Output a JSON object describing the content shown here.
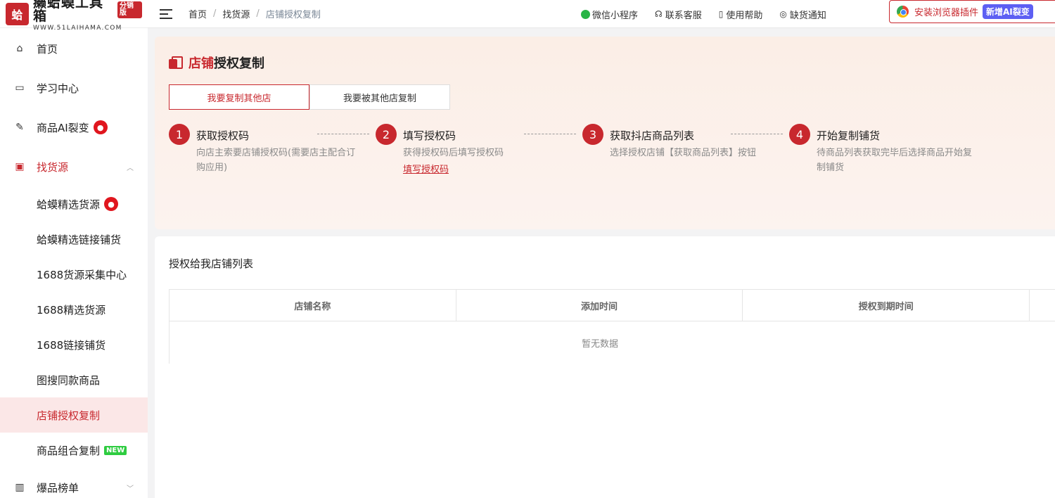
{
  "brand": {
    "logo_char": "蛤",
    "title": "癞蛤蟆工具箱",
    "badge": "分销版",
    "url": "WWW.51LAIHAMA.COM"
  },
  "sidebar": {
    "items": [
      {
        "label": "首页",
        "icon": "home-icon"
      },
      {
        "label": "学习中心",
        "icon": "book-icon"
      },
      {
        "label": "商品AI裂变",
        "icon": "magic-wand-icon",
        "badge": "fire"
      },
      {
        "label": "找货源",
        "icon": "bag-icon",
        "expanded": true
      },
      {
        "label": "蛤蟆精选货源",
        "badge": "fire"
      },
      {
        "label": "蛤蟆精选链接铺货"
      },
      {
        "label": "1688货源采集中心"
      },
      {
        "label": "1688精选货源"
      },
      {
        "label": "1688链接铺货"
      },
      {
        "label": "图搜同款商品"
      },
      {
        "label": "店铺授权复制",
        "active": true
      },
      {
        "label": "商品组合复制",
        "badge": "NEW"
      },
      {
        "label": "爆品榜单",
        "icon": "chart-icon"
      }
    ]
  },
  "breadcrumb": [
    "首页",
    "找货源",
    "店铺授权复制"
  ],
  "top_links": [
    "微信小程序",
    "联系客服",
    "使用帮助",
    "缺货通知"
  ],
  "plugin": {
    "label": "安装浏览器插件",
    "badge": "新增AI裂变"
  },
  "page": {
    "title_red": "店铺",
    "title_rest": "授权复制",
    "tabs": [
      "我要复制其他店",
      "我要被其他店复制"
    ],
    "steps": [
      {
        "num": "1",
        "title": "获取授权码",
        "desc": "向店主索要店铺授权码(需要店主配合订购应用)"
      },
      {
        "num": "2",
        "title": "填写授权码",
        "desc": "获得授权码后填写授权码",
        "link": "填写授权码"
      },
      {
        "num": "3",
        "title": "获取抖店商品列表",
        "desc": "选择授权店铺【获取商品列表】按钮"
      },
      {
        "num": "4",
        "title": "开始复制铺货",
        "desc": "待商品列表获取完毕后选择商品开始复制铺货"
      }
    ]
  },
  "table": {
    "title": "授权给我店铺列表",
    "columns": [
      "店铺名称",
      "添加时间",
      "授权到期时间",
      ""
    ],
    "empty_text": "暂无数据"
  },
  "colors": {
    "accent": "#c8282e",
    "ai_badge": "#5d5ff3",
    "new_badge": "#2ecc40"
  }
}
